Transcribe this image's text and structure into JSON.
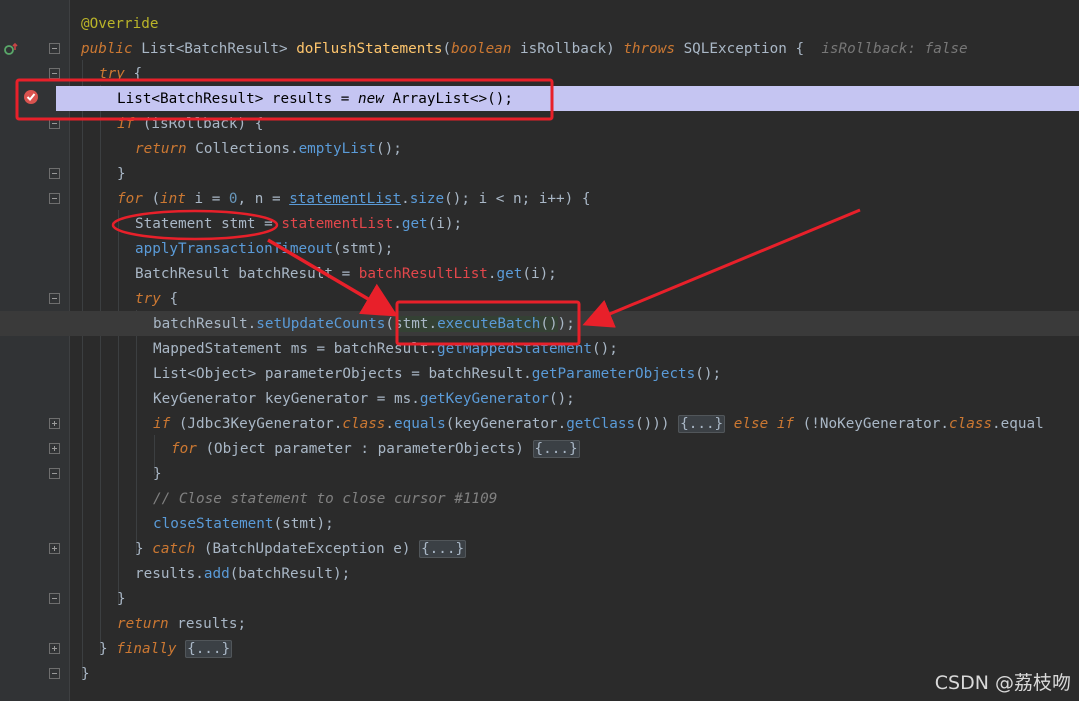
{
  "lines": [
    {
      "parts": [
        {
          "t": "@Override",
          "c": "ann"
        }
      ]
    },
    {
      "parts": [
        {
          "t": "public ",
          "c": "kw"
        },
        {
          "t": "List<BatchResult> "
        },
        {
          "t": "doFlushStatements",
          "c": "fn"
        },
        {
          "t": "("
        },
        {
          "t": "boolean ",
          "c": "kw"
        },
        {
          "t": "isRollback) "
        },
        {
          "t": "throws ",
          "c": "kw"
        },
        {
          "t": "SQLException {  "
        },
        {
          "t": "isRollback: false",
          "c": "hint"
        }
      ]
    },
    {
      "parts": [
        {
          "t": "try ",
          "c": "kw"
        },
        {
          "t": "{"
        }
      ]
    },
    {
      "parts": [
        {
          "t": "List<BatchResult> results = "
        },
        {
          "t": "new ",
          "c": "kw"
        },
        {
          "t": "ArrayList<>();"
        }
      ]
    },
    {
      "parts": [
        {
          "t": "if ",
          "c": "kw"
        },
        {
          "t": "(isRollback) {"
        }
      ]
    },
    {
      "parts": [
        {
          "t": "return ",
          "c": "kw"
        },
        {
          "t": "Collections."
        },
        {
          "t": "emptyList",
          "c": "mcall"
        },
        {
          "t": "();"
        }
      ]
    },
    {
      "parts": [
        {
          "t": "}"
        }
      ]
    },
    {
      "parts": [
        {
          "t": "for ",
          "c": "kw"
        },
        {
          "t": "("
        },
        {
          "t": "int ",
          "c": "kw"
        },
        {
          "t": "i = "
        },
        {
          "t": "0",
          "c": "num"
        },
        {
          "t": ", n = "
        },
        {
          "t": "statementList",
          "c": "fld-u"
        },
        {
          "t": "."
        },
        {
          "t": "size",
          "c": "mcall"
        },
        {
          "t": "(); i < n; i++) {"
        }
      ]
    },
    {
      "parts": [
        {
          "t": "Statement stmt = "
        },
        {
          "t": "statementList",
          "c": "fld"
        },
        {
          "t": "."
        },
        {
          "t": "get",
          "c": "mcall"
        },
        {
          "t": "(i);"
        }
      ]
    },
    {
      "parts": [
        {
          "t": "applyTransactionTimeout",
          "c": "mcall"
        },
        {
          "t": "(stmt);"
        }
      ]
    },
    {
      "parts": [
        {
          "t": "BatchResult batchResult = "
        },
        {
          "t": "batchResultList",
          "c": "fld"
        },
        {
          "t": "."
        },
        {
          "t": "get",
          "c": "mcall"
        },
        {
          "t": "(i);"
        }
      ]
    },
    {
      "parts": [
        {
          "t": "try ",
          "c": "kw"
        },
        {
          "t": "{"
        }
      ]
    },
    {
      "parts": [
        {
          "t": "batchResult."
        },
        {
          "t": "setUpdateCounts",
          "c": "mcall"
        },
        {
          "t": "("
        },
        {
          "t": "stmt.",
          "c": "hl"
        },
        {
          "t": "executeBatch",
          "c": "mcall hl"
        },
        {
          "t": "()",
          "c": "hl"
        },
        {
          "t": ");"
        }
      ]
    },
    {
      "parts": [
        {
          "t": "MappedStatement ms = batchResult."
        },
        {
          "t": "getMappedStatement",
          "c": "mcall"
        },
        {
          "t": "();"
        }
      ]
    },
    {
      "parts": [
        {
          "t": "List<Object> parameterObjects = batchResult."
        },
        {
          "t": "getParameterObjects",
          "c": "mcall"
        },
        {
          "t": "();"
        }
      ]
    },
    {
      "parts": [
        {
          "t": "KeyGenerator keyGenerator = ms."
        },
        {
          "t": "getKeyGenerator",
          "c": "mcall"
        },
        {
          "t": "();"
        }
      ]
    },
    {
      "parts": [
        {
          "t": "if ",
          "c": "kw"
        },
        {
          "t": "(Jdbc3KeyGenerator."
        },
        {
          "t": "class",
          "c": "kw"
        },
        {
          "t": "."
        },
        {
          "t": "equals",
          "c": "mcall"
        },
        {
          "t": "(keyGenerator."
        },
        {
          "t": "getClass",
          "c": "mcall"
        },
        {
          "t": "())) "
        },
        {
          "t": "{...}",
          "c": "fold-chip"
        },
        {
          "t": " "
        },
        {
          "t": "else if ",
          "c": "kw"
        },
        {
          "t": "(!NoKeyGenerator."
        },
        {
          "t": "class",
          "c": "kw"
        },
        {
          "t": ".equal"
        }
      ]
    },
    {
      "parts": [
        {
          "t": "for ",
          "c": "kw"
        },
        {
          "t": "(Object parameter : parameterObjects) "
        },
        {
          "t": "{...}",
          "c": "fold-chip"
        }
      ]
    },
    {
      "parts": [
        {
          "t": "}"
        }
      ]
    },
    {
      "parts": [
        {
          "t": "// Close statement to close cursor #1109",
          "c": "cmt"
        }
      ]
    },
    {
      "parts": [
        {
          "t": "closeStatement",
          "c": "mcall"
        },
        {
          "t": "(stmt);"
        }
      ]
    },
    {
      "parts": [
        {
          "t": "} "
        },
        {
          "t": "catch ",
          "c": "kw"
        },
        {
          "t": "(BatchUpdateException e) "
        },
        {
          "t": "{...}",
          "c": "fold-chip"
        }
      ]
    },
    {
      "parts": [
        {
          "t": "results."
        },
        {
          "t": "add",
          "c": "mcall"
        },
        {
          "t": "(batchResult);"
        }
      ]
    },
    {
      "parts": [
        {
          "t": "}"
        }
      ]
    },
    {
      "parts": [
        {
          "t": "return ",
          "c": "kw"
        },
        {
          "t": "results;"
        }
      ]
    },
    {
      "parts": [
        {
          "t": "} "
        },
        {
          "t": "finally ",
          "c": "kw"
        },
        {
          "t": "{...}",
          "c": "fold-chip"
        }
      ]
    },
    {
      "parts": [
        {
          "t": "}"
        }
      ]
    }
  ],
  "watermark": "CSDN @荔枝吻",
  "colors": {
    "background": "#2b2b2b",
    "gutter": "#313335",
    "breakpoint_line": "#c5c5f2",
    "annotation_box": "#e8202a",
    "keyword": "#cc7832",
    "method": "#5a9bd8",
    "field": "#e3474b"
  },
  "icons": [
    "breakpoint-icon",
    "override-icon",
    "fold-icon"
  ]
}
